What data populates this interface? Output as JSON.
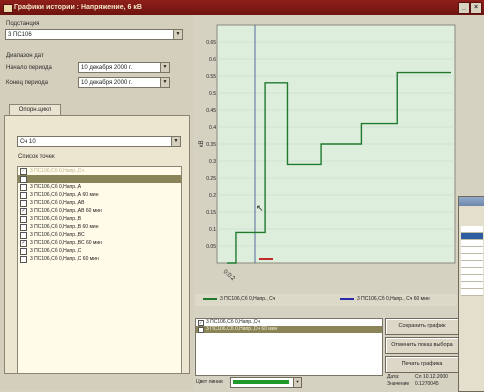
{
  "window": {
    "title": "Графики истории : Напряжение, 6 кВ"
  },
  "left": {
    "substation_label": "Подстанция",
    "substation_value": "3 ПС106",
    "range_label": "Диапазон дат",
    "start_label": "Начало периода",
    "start_value": "10 декабря 2000 г.",
    "end_label": "Конец периода",
    "end_value": "10 декабря 2000 г.",
    "tab_label": "Опорн.цикл",
    "group_value": "Сч 10",
    "list_label": "Список точек",
    "items": [
      {
        "label": "3 ПС106,Сб 0,Напр.,Сч",
        "checked": true,
        "state": "dim"
      },
      {
        "label": "",
        "checked": false,
        "state": "sel"
      },
      {
        "label": "3 ПС106,Сб 0,Напр.,А",
        "checked": false,
        "state": ""
      },
      {
        "label": "3 ПС106,Сб 0,Напр.,А 60 мин",
        "checked": false,
        "state": ""
      },
      {
        "label": "3 ПС106,Сб 0,Напр.,АВ",
        "checked": false,
        "state": ""
      },
      {
        "label": "3 ПС106,Сб 0,Напр.,АВ 60 мин",
        "checked": true,
        "state": ""
      },
      {
        "label": "3 ПС106,Сб 0,Напр.,В",
        "checked": false,
        "state": ""
      },
      {
        "label": "3 ПС106,Сб 0,Напр.,В 60 мин",
        "checked": false,
        "state": ""
      },
      {
        "label": "3 ПС106,Сб 0,Напр.,ВС",
        "checked": false,
        "state": ""
      },
      {
        "label": "3 ПС106,Сб 0,Напр.,ВС 60 мин",
        "checked": true,
        "state": ""
      },
      {
        "label": "3 ПС106,Сб 0,Напр.,С",
        "checked": false,
        "state": ""
      },
      {
        "label": "3 ПС106,Сб 0,Напр.,С 60 мин",
        "checked": false,
        "state": ""
      }
    ]
  },
  "chart_data": {
    "type": "line",
    "ylabel": "кВ",
    "ylim": [
      0,
      0.7
    ],
    "yticks": [
      "0.65",
      "0.6",
      "0.55",
      "0.5",
      "0.45",
      "0.4",
      "0.35",
      "0.3",
      "0.25",
      "0.2",
      "0.15",
      "0.1",
      "0.05"
    ],
    "xlabels": [
      "0:0:2"
    ],
    "series": [
      {
        "name": "3 ПС106,Сб 0,Напр.,Сч",
        "color": "#1f7a2e",
        "x": [
          0,
          4,
          4,
          17,
          17,
          27,
          27,
          42,
          42,
          60,
          60,
          76,
          76,
          100
        ],
        "y": [
          0.0,
          0.0,
          0.09,
          0.09,
          0.53,
          0.53,
          0.29,
          0.29,
          0.35,
          0.35,
          0.41,
          0.41,
          0.56,
          0.56
        ]
      }
    ],
    "legend": [
      {
        "label": "3 ПС106,Сб 0,Напр., Сч",
        "color": "#1f7a2e"
      },
      {
        "label": "3 ПС106,Сб 0,Напр., Сч 60 мин",
        "color": "#2a2aa8"
      }
    ]
  },
  "bottom_list": [
    {
      "label": "3 ПС106,Сб 0,Напр.,Сч",
      "checked": true,
      "state": ""
    },
    {
      "label": "3 ПС106,Сб 0,Напр.,Сч 60 мин",
      "checked": true,
      "state": "sel"
    }
  ],
  "buttons": {
    "save": "Сохранить график",
    "cancel": "Отменить показ выбора",
    "print": "Печать графика"
  },
  "status": {
    "date_label": "Дата:",
    "date_value": "Сл 10.12.2000",
    "value_label": "Значение",
    "value_value": "0.1270045"
  },
  "line_color_label": "Цвет линии"
}
